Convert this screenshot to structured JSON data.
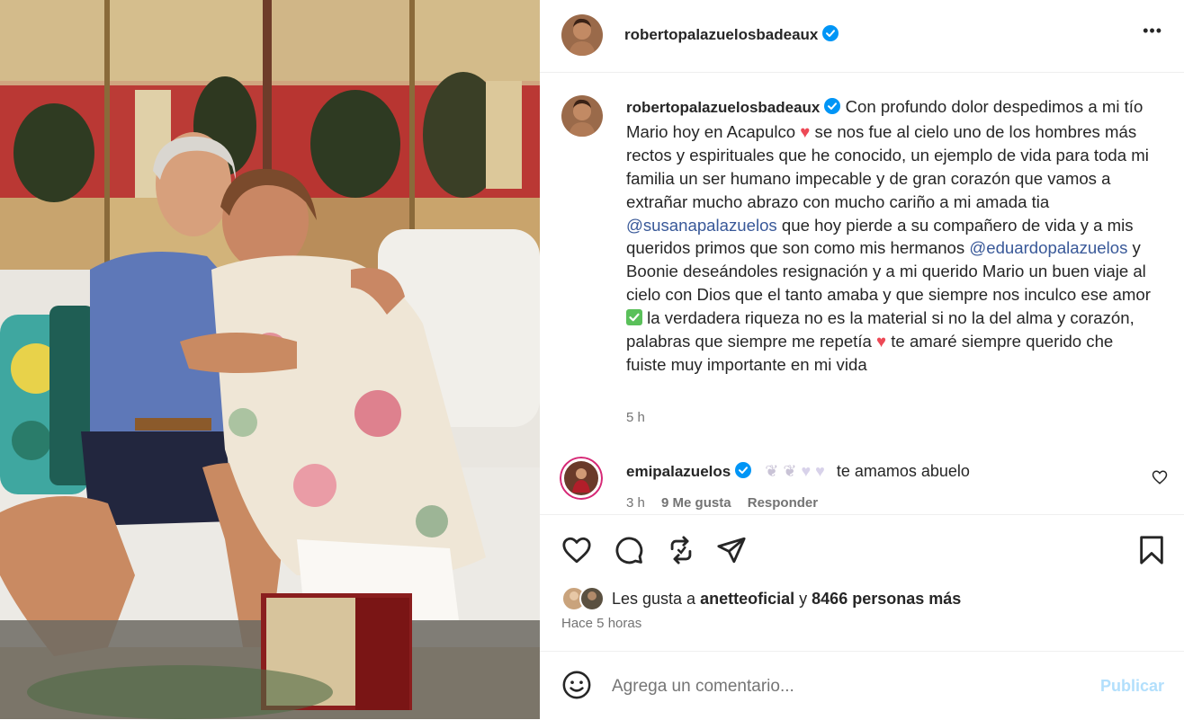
{
  "post": {
    "author": "robertopalazuelosbadeaux",
    "more_label": "•••"
  },
  "caption": {
    "author": "robertopalazuelosbadeaux",
    "part1": "Con profundo dolor despedimos a mi tío Mario hoy en Acapulco",
    "part2": "se nos fue al cielo uno de los hombres más rectos y espirituales que he conocido, un ejemplo de vida para toda mi familia un ser humano impecable y de gran corazón que vamos a extrañar mucho abrazo con mucho cariño a mi amada tia",
    "mention1": "@susanapalazuelos",
    "part3": "que hoy pierde a su compañero de vida y a mis queridos primos que son como mis hermanos",
    "mention2": "@eduardopalazuelos",
    "part4": "y Boonie deseándoles resignación y a mi querido Mario un buen viaje al cielo con Dios que el tanto amaba y que siempre nos inculco ese amor",
    "part5": "la verdadera riqueza no es la material si no la del alma y corazón, palabras que siempre me repetía",
    "part6": "te amaré siempre querido che fuiste muy importante en mi vida",
    "time": "5 h"
  },
  "comment": {
    "author": "emipalazuelos",
    "text": "te amamos abuelo",
    "time": "3 h",
    "likes": "9 Me gusta",
    "reply": "Responder"
  },
  "likes": {
    "prefix": "Les gusta a",
    "user": "anetteoficial",
    "connector": "y",
    "count": "8466 personas más",
    "timestamp": "Hace 5 horas"
  },
  "comment_box": {
    "placeholder": "Agrega un comentario...",
    "publish": "Publicar"
  },
  "colors": {
    "verified": "#0095f6",
    "heart": "#ed4956",
    "check": "#5ac05a",
    "publish_disabled": "#b2dffc"
  }
}
